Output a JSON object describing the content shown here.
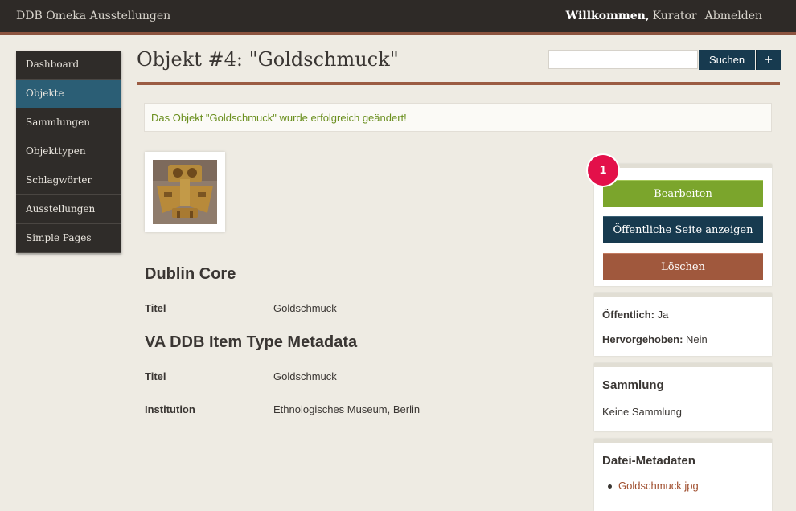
{
  "topbar": {
    "site_title": "DDB Omeka Ausstellungen",
    "welcome": "Willkommen,",
    "user": "Kurator",
    "logout": "Abmelden"
  },
  "nav": {
    "items": [
      "Dashboard",
      "Objekte",
      "Sammlungen",
      "Objekttypen",
      "Schlagwörter",
      "Ausstellungen",
      "Simple Pages"
    ],
    "active": "Objekte"
  },
  "page": {
    "title": "Objekt #4: \"Goldschmuck\""
  },
  "search": {
    "value": "",
    "button": "Suchen",
    "advanced": "+"
  },
  "flash": "Das Objekt \"Goldschmuck\" wurde erfolgreich geändert!",
  "metadata": {
    "dublin_core_heading": "Dublin Core",
    "dc_title_label": "Titel",
    "dc_title_value": "Goldschmuck",
    "va_heading": "VA DDB Item Type Metadata",
    "va_title_label": "Titel",
    "va_title_value": "Goldschmuck",
    "institution_label": "Institution",
    "institution_value": "Ethnologisches Museum, Berlin"
  },
  "actions": {
    "badge": "1",
    "edit": "Bearbeiten",
    "view_public": "Öffentliche Seite anzeigen",
    "delete": "Löschen"
  },
  "status": {
    "public_label": "Öffentlich:",
    "public_value": "Ja",
    "featured_label": "Hervorgehoben:",
    "featured_value": "Nein"
  },
  "collection": {
    "heading": "Sammlung",
    "value": "Keine Sammlung"
  },
  "files": {
    "heading": "Datei-Metadaten",
    "items": [
      "Goldschmuck.jpg"
    ]
  },
  "colors": {
    "topbar": "#2e2a27",
    "accent_rule": "#9b5c43",
    "active_nav": "#2b5e75",
    "edit_button": "#7ba52c",
    "public_button": "#173a4f",
    "delete_button": "#a0583d",
    "badge": "#e3104a"
  }
}
